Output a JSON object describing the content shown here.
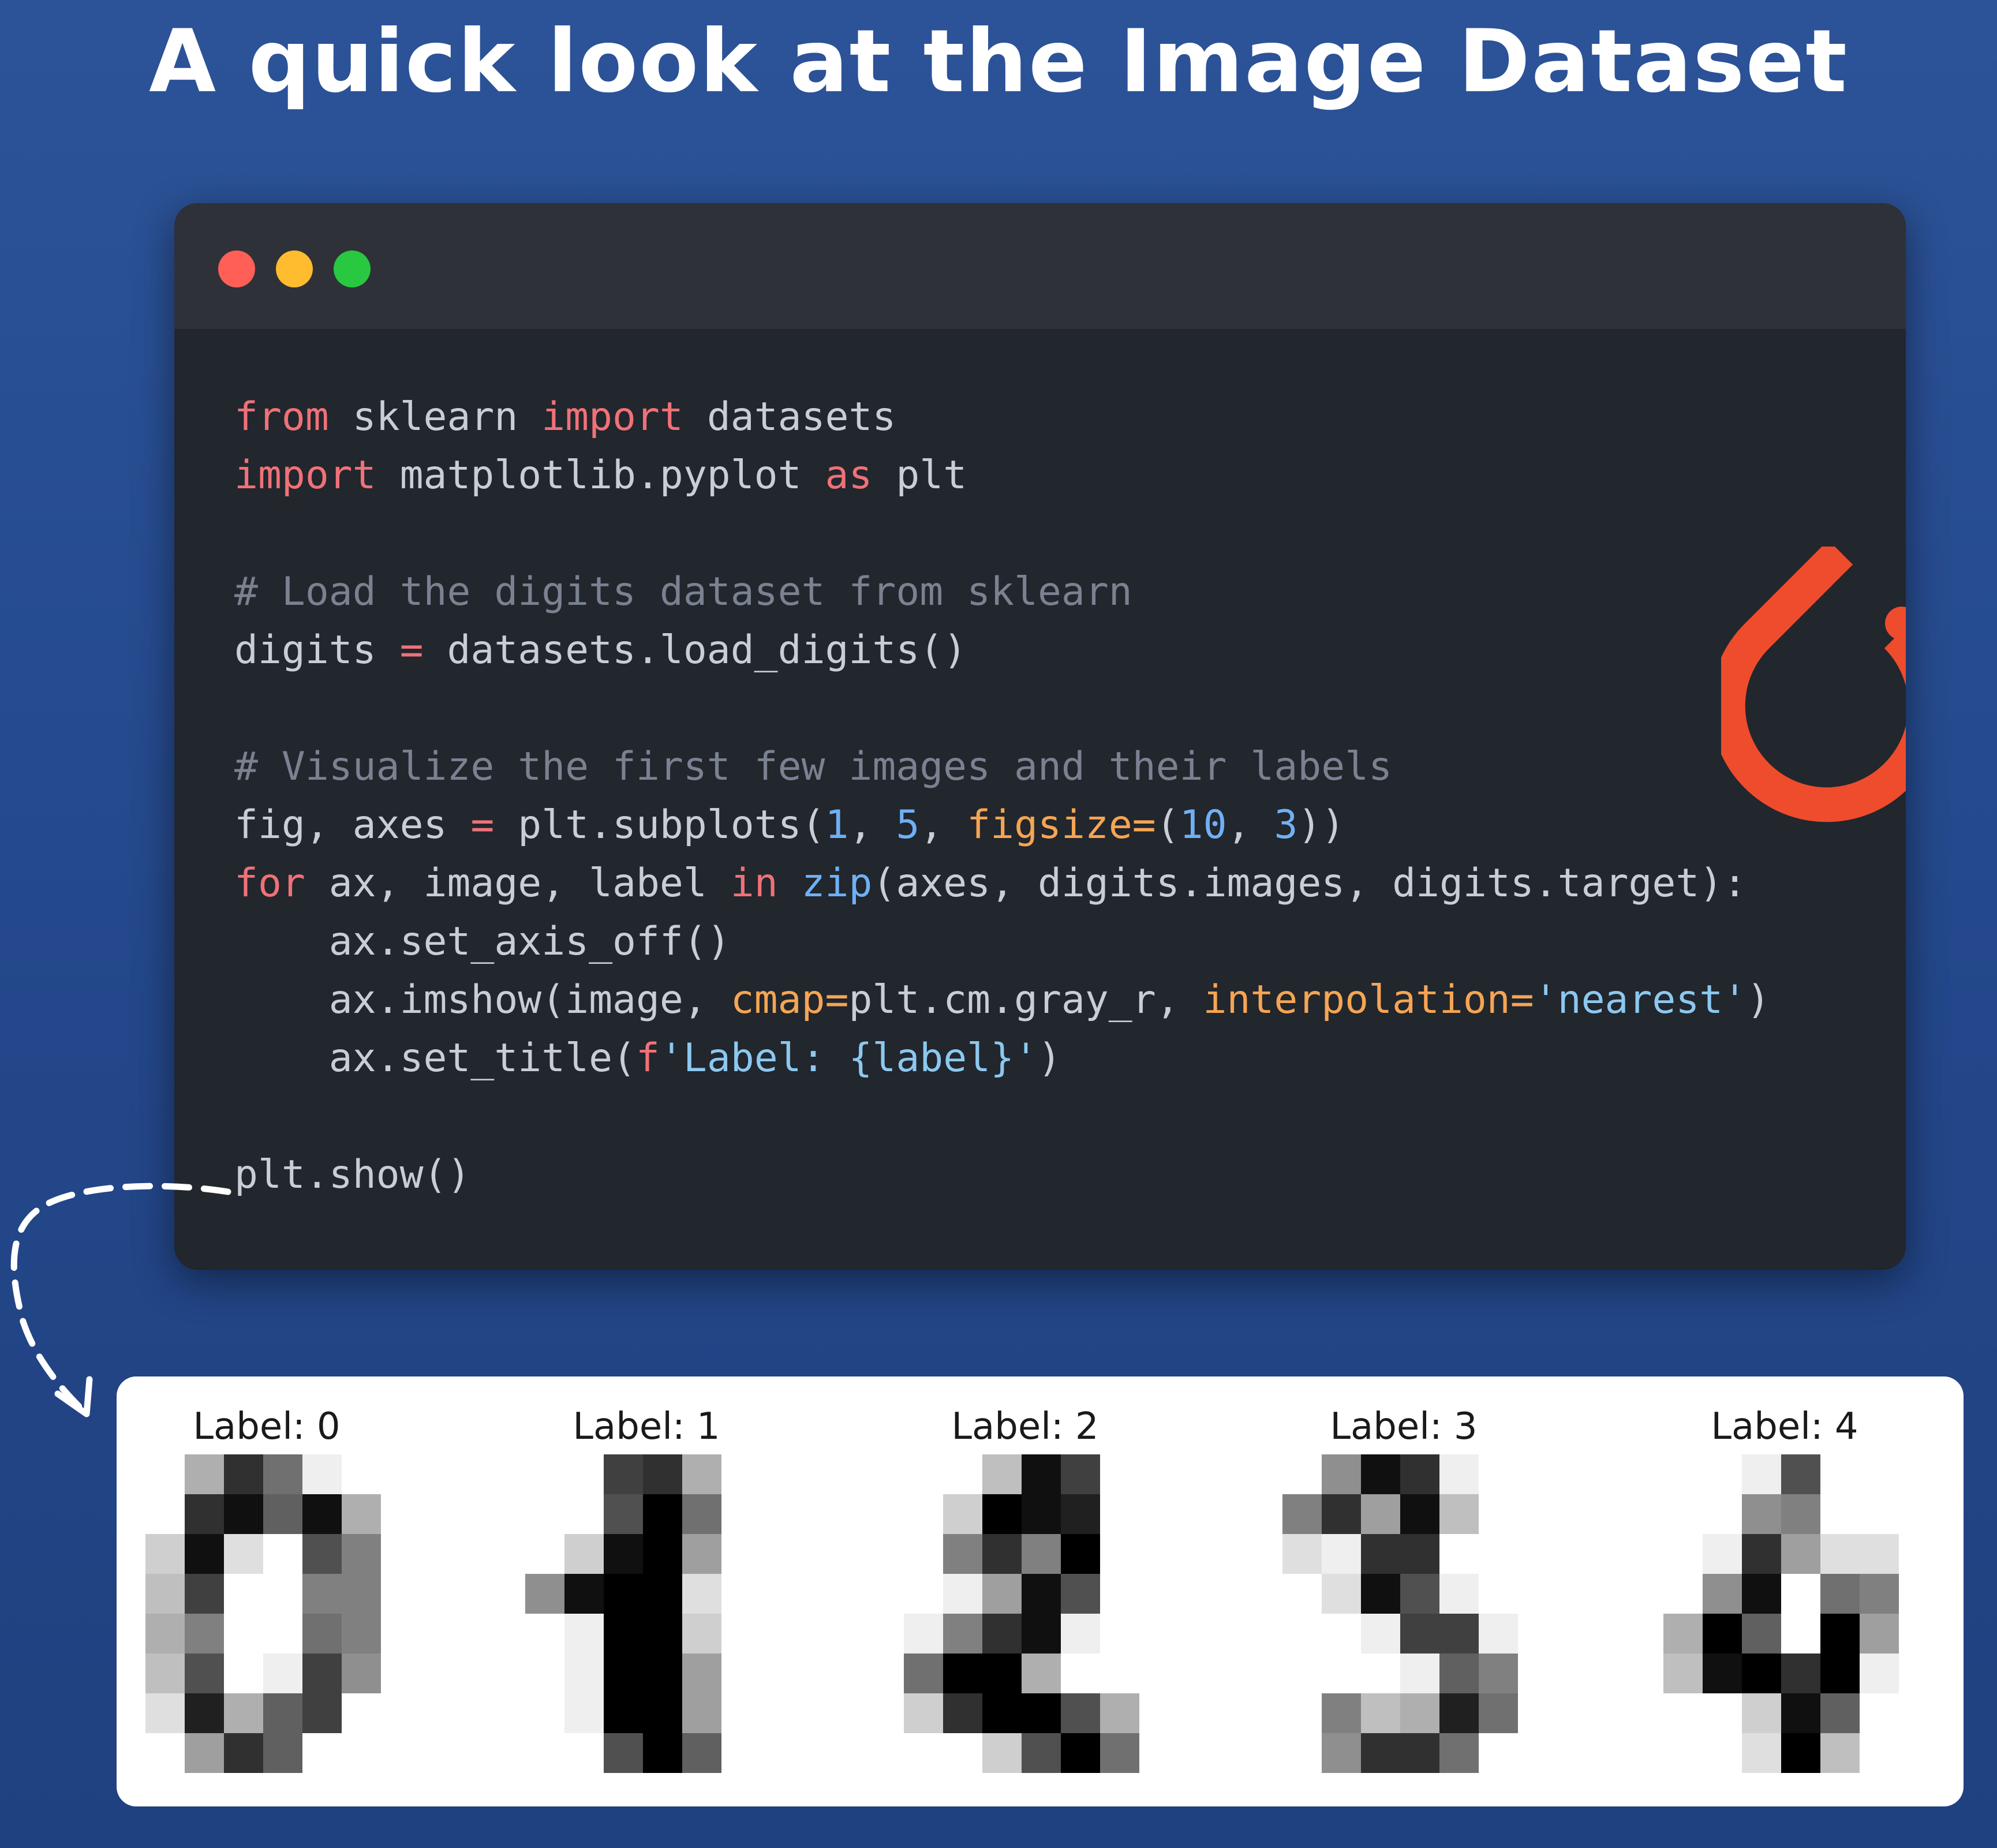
{
  "title": "A quick look at the Image Dataset",
  "window": {
    "controls": [
      {
        "name": "close",
        "color": "#ff5f57"
      },
      {
        "name": "minimize",
        "color": "#febc2e"
      },
      {
        "name": "maximize",
        "color": "#28c840"
      }
    ],
    "logo": {
      "icon": "pytorch-logo-icon",
      "color": "#ee4c2c"
    }
  },
  "code_lines": [
    [
      [
        "from",
        "k"
      ],
      [
        " sklearn ",
        ""
      ],
      [
        "import",
        "k"
      ],
      [
        " datasets",
        ""
      ]
    ],
    [
      [
        "import",
        "k"
      ],
      [
        " matplotlib.pyplot ",
        ""
      ],
      [
        "as",
        "k"
      ],
      [
        " plt",
        ""
      ]
    ],
    [],
    [
      [
        "# Load the digits dataset from sklearn",
        "c"
      ]
    ],
    [
      [
        "digits ",
        ""
      ],
      [
        "=",
        "k"
      ],
      [
        " datasets.load_digits()",
        ""
      ]
    ],
    [],
    [
      [
        "# Visualize the first few images and their labels",
        "c"
      ]
    ],
    [
      [
        "fig, axes ",
        ""
      ],
      [
        "=",
        "k"
      ],
      [
        " plt.subplots(",
        ""
      ],
      [
        "1",
        "n"
      ],
      [
        ", ",
        ""
      ],
      [
        "5",
        "n"
      ],
      [
        ", ",
        ""
      ],
      [
        "figsize=",
        "a"
      ],
      [
        "(",
        ""
      ],
      [
        "10",
        "n"
      ],
      [
        ", ",
        ""
      ],
      [
        "3",
        "n"
      ],
      [
        "))",
        ""
      ]
    ],
    [
      [
        "for",
        "k"
      ],
      [
        " ax, image, label ",
        ""
      ],
      [
        "in",
        "k"
      ],
      [
        " ",
        ""
      ],
      [
        "zip",
        "n"
      ],
      [
        "(axes, digits.images, digits.target):",
        ""
      ]
    ],
    [
      [
        "    ax.set_axis_off()",
        ""
      ]
    ],
    [
      [
        "    ax.imshow(image, ",
        ""
      ],
      [
        "cmap=",
        "a"
      ],
      [
        "plt.cm.gray_r, ",
        ""
      ],
      [
        "interpolation=",
        "a"
      ],
      [
        "'nearest'",
        "s"
      ],
      [
        ")",
        ""
      ]
    ],
    [
      [
        "    ax.set_title(",
        ""
      ],
      [
        "f",
        "k"
      ],
      [
        "'Label: {label}'",
        "s"
      ],
      [
        ")",
        ""
      ]
    ],
    [],
    [
      [
        "plt.show()",
        ""
      ]
    ]
  ],
  "output": {
    "digits": [
      {
        "label": "Label: 0",
        "pixels": [
          [
            0,
            0,
            5,
            13,
            9,
            1,
            0,
            0
          ],
          [
            0,
            0,
            13,
            15,
            10,
            15,
            5,
            0
          ],
          [
            0,
            3,
            15,
            2,
            0,
            11,
            8,
            0
          ],
          [
            0,
            4,
            12,
            0,
            0,
            8,
            8,
            0
          ],
          [
            0,
            5,
            8,
            0,
            0,
            9,
            8,
            0
          ],
          [
            0,
            4,
            11,
            0,
            1,
            12,
            7,
            0
          ],
          [
            0,
            2,
            14,
            5,
            10,
            12,
            0,
            0
          ],
          [
            0,
            0,
            6,
            13,
            10,
            0,
            0,
            0
          ]
        ]
      },
      {
        "label": "Label: 1",
        "pixels": [
          [
            0,
            0,
            0,
            12,
            13,
            5,
            0,
            0
          ],
          [
            0,
            0,
            0,
            11,
            16,
            9,
            0,
            0
          ],
          [
            0,
            0,
            3,
            15,
            16,
            6,
            0,
            0
          ],
          [
            0,
            7,
            15,
            16,
            16,
            2,
            0,
            0
          ],
          [
            0,
            0,
            1,
            16,
            16,
            3,
            0,
            0
          ],
          [
            0,
            0,
            1,
            16,
            16,
            6,
            0,
            0
          ],
          [
            0,
            0,
            1,
            16,
            16,
            6,
            0,
            0
          ],
          [
            0,
            0,
            0,
            11,
            16,
            10,
            0,
            0
          ]
        ]
      },
      {
        "label": "Label: 2",
        "pixels": [
          [
            0,
            0,
            0,
            4,
            15,
            12,
            0,
            0
          ],
          [
            0,
            0,
            3,
            16,
            15,
            14,
            0,
            0
          ],
          [
            0,
            0,
            8,
            13,
            8,
            16,
            0,
            0
          ],
          [
            0,
            0,
            1,
            6,
            15,
            11,
            0,
            0
          ],
          [
            0,
            1,
            8,
            13,
            15,
            1,
            0,
            0
          ],
          [
            0,
            9,
            16,
            16,
            5,
            0,
            0,
            0
          ],
          [
            0,
            3,
            13,
            16,
            16,
            11,
            5,
            0
          ],
          [
            0,
            0,
            0,
            3,
            11,
            16,
            9,
            0
          ]
        ]
      },
      {
        "label": "Label: 3",
        "pixels": [
          [
            0,
            0,
            7,
            15,
            13,
            1,
            0,
            0
          ],
          [
            0,
            8,
            13,
            6,
            15,
            4,
            0,
            0
          ],
          [
            0,
            2,
            1,
            13,
            13,
            0,
            0,
            0
          ],
          [
            0,
            0,
            2,
            15,
            11,
            1,
            0,
            0
          ],
          [
            0,
            0,
            0,
            1,
            12,
            12,
            1,
            0
          ],
          [
            0,
            0,
            0,
            0,
            1,
            10,
            8,
            0
          ],
          [
            0,
            0,
            8,
            4,
            5,
            14,
            9,
            0
          ],
          [
            0,
            0,
            7,
            13,
            13,
            9,
            0,
            0
          ]
        ]
      },
      {
        "label": "Label: 4",
        "pixels": [
          [
            0,
            0,
            0,
            1,
            11,
            0,
            0,
            0
          ],
          [
            0,
            0,
            0,
            7,
            8,
            0,
            0,
            0
          ],
          [
            0,
            0,
            1,
            13,
            6,
            2,
            2,
            0
          ],
          [
            0,
            0,
            7,
            15,
            0,
            9,
            8,
            0
          ],
          [
            0,
            5,
            16,
            10,
            0,
            16,
            6,
            0
          ],
          [
            0,
            4,
            15,
            16,
            13,
            16,
            1,
            0
          ],
          [
            0,
            0,
            0,
            3,
            15,
            10,
            0,
            0
          ],
          [
            0,
            0,
            0,
            2,
            16,
            4,
            0,
            0
          ]
        ]
      }
    ]
  }
}
